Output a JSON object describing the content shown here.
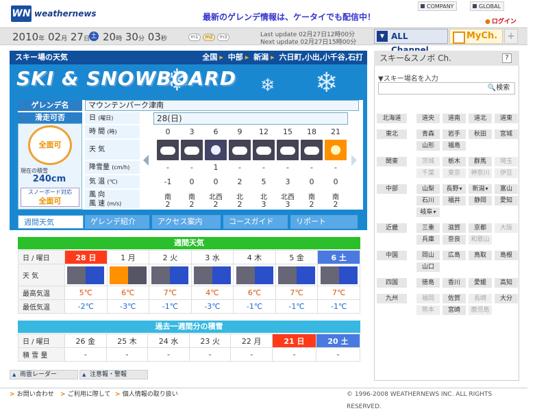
{
  "header": {
    "brand": "weathernews",
    "logo_text": "WN",
    "promo": "最新のゲレンデ情報は、ケータイでも配信中！",
    "company_link": "COMPANY",
    "global_link": "GLOBAL",
    "login": "ログイン"
  },
  "datebar": {
    "year": "2010",
    "year_u": "年",
    "month": "02",
    "month_u": "月",
    "day": "27",
    "day_u": "日",
    "weekday": "土",
    "hour": "20",
    "hour_u": "時",
    "minute": "30",
    "minute_u": "分",
    "second": "03",
    "second_u": "秒",
    "m1": "m1",
    "m2": "m2",
    "m3": "m3",
    "last_update": "Last update  02月27日12時00分",
    "next_update": "Next update  02月27日15時00分",
    "all_channel": "ALL Channel",
    "my_ch": "MyCh.",
    "plus": "+"
  },
  "main": {
    "title": "スキー場の天気",
    "crumbs": [
      "全国",
      "中部",
      "新潟",
      "六日町,小出,小千谷,石打"
    ],
    "banner": "SKI & SNOWBOARD",
    "gelande_label": "ゲレンデ名",
    "gelande_name": "マウンテンパーク津南",
    "open_label": "滑走可否",
    "open_status": "全面可",
    "snow_depth_label": "現在の積雪",
    "snow_depth": "240cm",
    "snowboard_label": "スノーボード対応",
    "snowboard_status": "全面可",
    "row_labels": {
      "date": "日",
      "date_sub": "(曜日)",
      "time": "時 間",
      "time_sub": "(時)",
      "weather": "天 気",
      "snowfall": "降雪量",
      "snowfall_sub": "(cm/h)",
      "temp": "気 温",
      "temp_sub": "(℃)",
      "wind": "風 向",
      "wind2": "風 速",
      "wind_sub": "(m/s)"
    },
    "date_header": "28(日)",
    "hours": [
      "0",
      "3",
      "6",
      "9",
      "12",
      "15",
      "18",
      "21"
    ],
    "hourly_icons": [
      "cloud-icon",
      "cloud-icon",
      "snow-icon",
      "cloud-icon",
      "cloud-icon",
      "cloud-icon",
      "cloud-icon",
      "sun-icon"
    ],
    "snowfall": [
      "-",
      "-",
      "1",
      "-",
      "-",
      "-",
      "-",
      "-"
    ],
    "temps": [
      "-1",
      "0",
      "0",
      "2",
      "5",
      "3",
      "0",
      "0"
    ],
    "wind_dir": [
      "南",
      "南",
      "北西",
      "北",
      "北",
      "北西",
      "南",
      "南"
    ],
    "wind_speed": [
      "2",
      "2",
      "2",
      "2",
      "3",
      "3",
      "2",
      "2"
    ],
    "tabs": [
      "週間天気",
      "ゲレンデ紹介",
      "アクセス案内",
      "コースガイド",
      "リポート"
    ]
  },
  "weekly": {
    "title": "週間天気",
    "row_labels": [
      "日 / 曜日",
      "天 気",
      "最高気温",
      "最低気温"
    ],
    "days": [
      "28 日",
      "1 月",
      "2 火",
      "3 水",
      "4 木",
      "5 金",
      "6 土"
    ],
    "icons": [
      "cloud-snow-icon",
      "sun-cloud-icon",
      "cloud-snow-icon",
      "cloud-snow-icon",
      "cloud-snow-icon",
      "cloud-snow-icon",
      "cloud-snow-icon"
    ],
    "highs": [
      "5℃",
      "6℃",
      "7℃",
      "4℃",
      "6℃",
      "7℃",
      "7℃"
    ],
    "lows": [
      "-2℃",
      "-3℃",
      "-1℃",
      "-3℃",
      "-1℃",
      "-1℃",
      "-1℃"
    ]
  },
  "past": {
    "title": "過去一週間分の積雪",
    "row_labels": [
      "日 / 曜日",
      "積 雪 量"
    ],
    "days": [
      "26 金",
      "25 木",
      "24 水",
      "23 火",
      "22 月",
      "21 日",
      "20 土"
    ],
    "values": [
      "-",
      "-",
      "-",
      "-",
      "-",
      "-",
      "-"
    ]
  },
  "bottom_links": [
    "雨雲レーダー",
    "注意報・警報"
  ],
  "footer": {
    "links": [
      "お問い合わせ",
      "ご利用に際して",
      "個人情報の取り扱い"
    ],
    "copyright": "© 1996-2008 WEATHERNEWS INC. ALL RIGHTS RESERVED."
  },
  "right_panel": {
    "title": "スキー&スノボ Ch.",
    "help": "?",
    "search_label": "▼スキー場名を入力",
    "search_button": "検索",
    "regions": [
      {
        "name": "北海道",
        "prefs": [
          {
            "n": "道央",
            "d": false
          },
          {
            "n": "道南",
            "d": false
          },
          {
            "n": "道北",
            "d": false
          },
          {
            "n": "道東",
            "d": false
          }
        ]
      },
      {
        "name": "東北",
        "prefs": [
          {
            "n": "青森",
            "d": false
          },
          {
            "n": "岩手",
            "d": false
          },
          {
            "n": "秋田",
            "d": false
          },
          {
            "n": "宮城",
            "d": false
          },
          {
            "n": "山形",
            "d": false
          },
          {
            "n": "福島",
            "d": false
          }
        ]
      },
      {
        "name": "関東",
        "prefs": [
          {
            "n": "茨城",
            "d": true
          },
          {
            "n": "栃木",
            "d": false
          },
          {
            "n": "群馬",
            "d": false
          },
          {
            "n": "埼玉",
            "d": true
          },
          {
            "n": "千葉",
            "d": true
          },
          {
            "n": "東京",
            "d": true
          },
          {
            "n": "神奈川",
            "d": true
          },
          {
            "n": "伊豆",
            "d": true
          }
        ]
      },
      {
        "name": "中部",
        "prefs": [
          {
            "n": "山梨",
            "d": false
          },
          {
            "n": "長野",
            "d": false,
            "dd": true
          },
          {
            "n": "新潟",
            "d": false,
            "dd": true
          },
          {
            "n": "富山",
            "d": false
          },
          {
            "n": "石川",
            "d": false
          },
          {
            "n": "福井",
            "d": false
          },
          {
            "n": "静岡",
            "d": false
          },
          {
            "n": "愛知",
            "d": false
          },
          {
            "n": "岐阜",
            "d": false,
            "dd": true
          }
        ]
      },
      {
        "name": "近畿",
        "prefs": [
          {
            "n": "三重",
            "d": false
          },
          {
            "n": "滋賀",
            "d": false
          },
          {
            "n": "京都",
            "d": false
          },
          {
            "n": "大阪",
            "d": true
          },
          {
            "n": "兵庫",
            "d": false
          },
          {
            "n": "奈良",
            "d": false
          },
          {
            "n": "和歌山",
            "d": true
          }
        ]
      },
      {
        "name": "中国",
        "prefs": [
          {
            "n": "岡山",
            "d": false
          },
          {
            "n": "広島",
            "d": false
          },
          {
            "n": "鳥取",
            "d": false
          },
          {
            "n": "島根",
            "d": false
          },
          {
            "n": "山口",
            "d": false
          }
        ]
      },
      {
        "name": "四国",
        "prefs": [
          {
            "n": "徳島",
            "d": false
          },
          {
            "n": "香川",
            "d": false
          },
          {
            "n": "愛媛",
            "d": false
          },
          {
            "n": "高知",
            "d": false
          }
        ]
      },
      {
        "name": "九州",
        "prefs": [
          {
            "n": "福岡",
            "d": true
          },
          {
            "n": "佐賀",
            "d": false
          },
          {
            "n": "長崎",
            "d": true
          },
          {
            "n": "大分",
            "d": false
          },
          {
            "n": "熊本",
            "d": true
          },
          {
            "n": "宮崎",
            "d": false
          },
          {
            "n": "鹿児島",
            "d": true
          }
        ]
      }
    ]
  },
  "colors": {
    "brand": "#1a4fa0",
    "accent": "#1a88d0",
    "sunday": "#ff3a1a",
    "saturday": "#4a7ae0",
    "green": "#2bc02b",
    "cyan": "#38b8e0"
  }
}
